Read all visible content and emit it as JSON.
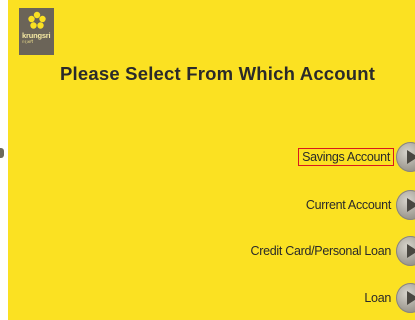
{
  "logo": {
    "brand": "krungsri",
    "sub": "กรุงศรี"
  },
  "title": "Please Select From Which Account",
  "options": [
    {
      "label": "Savings Account",
      "selected": true
    },
    {
      "label": "Current Account",
      "selected": false
    },
    {
      "label": "Credit Card/Personal Loan",
      "selected": false
    },
    {
      "label": "Loan",
      "selected": false
    }
  ],
  "colors": {
    "background": "#fbe122",
    "logo_bg": "#6b6458",
    "selection_border": "#d9181e",
    "text": "#2a2a2a"
  }
}
